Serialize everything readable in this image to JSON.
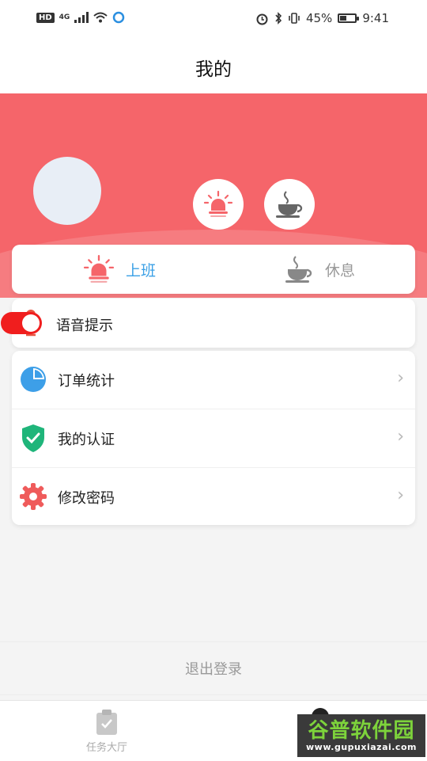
{
  "status_bar": {
    "hd": "HD",
    "network": "4G",
    "battery": "45%",
    "battery_level": 0.45,
    "time": "9:41"
  },
  "header": {
    "title": "我的"
  },
  "work_status": {
    "on_label": "上班",
    "rest_label": "休息",
    "active": "on"
  },
  "voice": {
    "label": "语音提示",
    "enabled": true
  },
  "menu": {
    "items": [
      {
        "label": "订单统计",
        "icon": "pie-chart-icon"
      },
      {
        "label": "我的认证",
        "icon": "shield-check-icon"
      },
      {
        "label": "修改密码",
        "icon": "gear-icon"
      }
    ]
  },
  "logout": {
    "label": "退出登录"
  },
  "bottom_nav": {
    "task_hall": "任务大厅"
  },
  "watermark": {
    "title": "谷普软件园",
    "url": "www.gupuxiazai.com"
  },
  "colors": {
    "accent": "#f5656a",
    "active_tab": "#3aa0e6",
    "switch_on": "#f01e1e"
  }
}
